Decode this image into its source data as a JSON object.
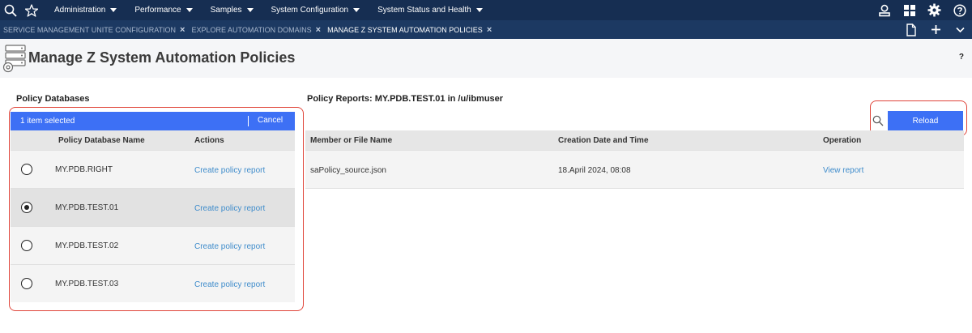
{
  "topnav": {
    "menu": [
      "Administration",
      "Performance",
      "Samples",
      "System Configuration",
      "System Status and Health"
    ],
    "icons": [
      "search-icon",
      "star-icon",
      "user-icon",
      "grid-icon",
      "gear-icon",
      "help-icon"
    ]
  },
  "tabs": [
    {
      "label": "SERVICE MANAGEMENT UNITE CONFIGURATION",
      "active": false
    },
    {
      "label": "EXPLORE AUTOMATION DOMAINS",
      "active": false
    },
    {
      "label": "MANAGE Z SYSTEM AUTOMATION POLICIES",
      "active": true
    }
  ],
  "tab_close": "×",
  "tabbar_icons": [
    "document-icon",
    "plus-icon",
    "chevron-down-icon"
  ],
  "header": {
    "title": "Manage Z System Automation Policies",
    "help": "?"
  },
  "left": {
    "title": "Policy Databases",
    "selection": {
      "text": "1 item selected",
      "cancel": "Cancel"
    },
    "columns": [
      "Policy Database Name",
      "Actions"
    ],
    "rows": [
      {
        "name": "MY.PDB.RIGHT",
        "action": "Create policy report",
        "selected": false
      },
      {
        "name": "MY.PDB.TEST.01",
        "action": "Create policy report",
        "selected": true
      },
      {
        "name": "MY.PDB.TEST.02",
        "action": "Create policy report",
        "selected": false
      },
      {
        "name": "MY.PDB.TEST.03",
        "action": "Create policy report",
        "selected": false
      }
    ]
  },
  "right": {
    "title": "Policy Reports: MY.PDB.TEST.01 in /u/ibmuser",
    "reload": "Reload",
    "columns": [
      "Member or File Name",
      "Creation Date and Time",
      "Operation"
    ],
    "rows": [
      {
        "file": "saPolicy_source.json",
        "date": "18.April 2024, 08:08",
        "operation": "View report"
      }
    ]
  },
  "colors": {
    "nav": "#162e52",
    "tabbar": "#1c3962",
    "accent": "#3d70f5",
    "link": "#3f8ccb",
    "highlight": "#e0453a"
  }
}
